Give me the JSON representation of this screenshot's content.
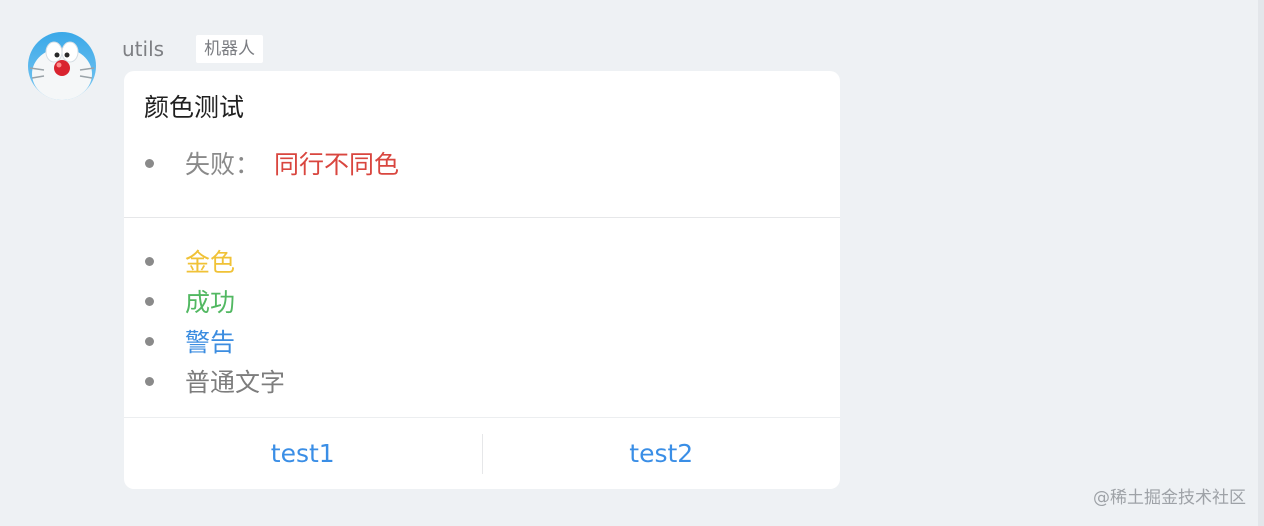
{
  "sender": {
    "name": "utils",
    "badge": "机器人"
  },
  "card": {
    "title": "颜色测试",
    "section1": {
      "label": "失败：",
      "value": "同行不同色"
    },
    "list": [
      {
        "text": "金色",
        "color": "#f0c237"
      },
      {
        "text": "成功",
        "color": "#52b862"
      },
      {
        "text": "警告",
        "color": "#3c8de0"
      },
      {
        "text": "普通文字",
        "color": "#7d7d7d"
      }
    ],
    "actions": [
      {
        "label": "test1"
      },
      {
        "label": "test2"
      }
    ]
  },
  "watermark": "@稀土掘金技术社区",
  "colors": {
    "background": "#eef1f4",
    "danger": "#d9463f",
    "link": "#3a8ee6"
  },
  "icons": {
    "avatar": "doraemon-avatar-icon"
  }
}
